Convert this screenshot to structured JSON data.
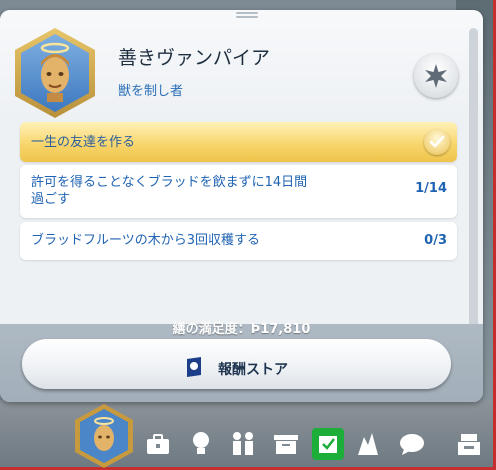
{
  "aspiration": {
    "title": "善きヴァンパイア",
    "subtitle": "獣を制し者"
  },
  "goals": [
    {
      "text": "一生の友達を作る",
      "count": "",
      "completed": true
    },
    {
      "text_line1": "許可を得ることなくブラッドを飲まずに14日間",
      "text_line2": "過ごす",
      "count": "1/14",
      "completed": false
    },
    {
      "text": "ブラッドフルーツの木から3回収穫する",
      "count": "0/3",
      "completed": false
    }
  ],
  "footer": {
    "satisfaction_label": "繕の満足度：",
    "satisfaction_value": "17,810",
    "reward_store_label": "報酬ストア"
  },
  "icons": {
    "star": "star-badge-icon",
    "check": "check-icon",
    "reward": "reward-store-icon",
    "bottom_bar": [
      "aspiration-icon",
      "career-icon",
      "skills-icon",
      "relationships-icon",
      "inventory-icon",
      "whims-icon",
      "club-icon",
      "chat-icon",
      "household-icon"
    ]
  },
  "colors": {
    "accent_blue": "#1f63b3",
    "completed_gold": "#f3cf5e",
    "panel_bg": "#eef1f4"
  }
}
